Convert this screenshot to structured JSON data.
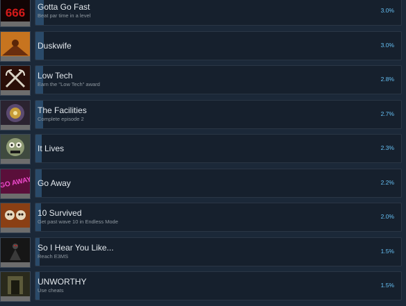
{
  "achievements": [
    {
      "title": "Gotta Go Fast",
      "description": "Beat par time in a level",
      "percent_label": "3.0%",
      "percent": 3.0,
      "icon": "666-icon",
      "icon_text": "666"
    },
    {
      "title": "Duskwife",
      "description": "",
      "percent_label": "3.0%",
      "percent": 3.0,
      "icon": "duskwife-icon"
    },
    {
      "title": "Low Tech",
      "description": "Earn the \"Low Tech\" award",
      "percent_label": "2.8%",
      "percent": 2.8,
      "icon": "crossed-sickles-icon"
    },
    {
      "title": "The Facilities",
      "description": "Complete episode 2",
      "percent_label": "2.7%",
      "percent": 2.7,
      "icon": "vortex-icon"
    },
    {
      "title": "It Lives",
      "description": "",
      "percent_label": "2.3%",
      "percent": 2.3,
      "icon": "creature-face-icon"
    },
    {
      "title": "Go Away",
      "description": "",
      "percent_label": "2.2%",
      "percent": 2.2,
      "icon": "go-away-icon",
      "icon_text": "GO AWAY"
    },
    {
      "title": "10 Survived",
      "description": "Get past wave 10 in Endless Mode",
      "percent_label": "2.0%",
      "percent": 2.0,
      "icon": "skulls-icon"
    },
    {
      "title": "So I Hear You Like...",
      "description": "Reach E3MS",
      "percent_label": "1.5%",
      "percent": 1.5,
      "icon": "dark-figure-icon"
    },
    {
      "title": "UNWORTHY",
      "description": "Use cheats",
      "percent_label": "1.5%",
      "percent": 1.5,
      "icon": "doorway-icon"
    }
  ],
  "colors": {
    "background": "#1b2838",
    "card": "#16202d",
    "progress_fill": "#2a4a69",
    "percent_text": "#66c0f4"
  }
}
